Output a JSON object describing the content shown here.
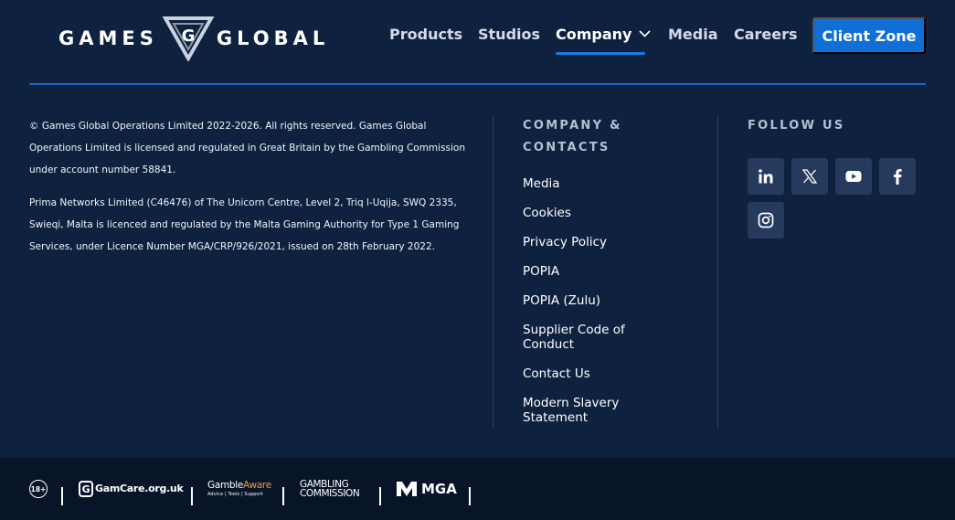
{
  "brand": {
    "word_left": "GAMES",
    "word_right": "GLOBAL",
    "mark_letter": "G"
  },
  "nav": {
    "items": [
      {
        "label": "Products"
      },
      {
        "label": "Studios"
      },
      {
        "label": "Company"
      },
      {
        "label": "Media"
      },
      {
        "label": "Careers"
      }
    ],
    "active": "Company",
    "cta_label": "Client Zone"
  },
  "legal": {
    "paragraph_1": "© Games Global Operations Limited 2022-2026. All rights reserved. Games Global Operations Limited is licensed and regulated in Great Britain by the Gambling Commission under account number 58841.",
    "paragraph_2": "Prima Networks Limited (C46476) of The Unicorn Centre, Level 2, Triq l-Uqija, SWQ 2335, Swieqi, Malta is licenced and regulated by the Malta Gaming Authority for Type 1 Gaming Services, under Licence Number MGA/CRP/926/2021, issued on 28th February 2022."
  },
  "company": {
    "title_line_1": "COMPANY &",
    "title_line_2": "CONTACTS",
    "links": [
      {
        "label": "Media"
      },
      {
        "label": "Cookies"
      },
      {
        "label": "Privacy Policy"
      },
      {
        "label": "POPIA"
      },
      {
        "label": "POPIA (Zulu)"
      },
      {
        "label": "Supplier Code of Conduct"
      },
      {
        "label": "Contact Us"
      },
      {
        "label": "Modern Slavery Statement"
      }
    ]
  },
  "follow": {
    "title": "FOLLOW US",
    "icons": [
      "linkedin-icon",
      "x-icon",
      "youtube-icon",
      "facebook-icon",
      "instagram-icon"
    ]
  },
  "bottom": {
    "age_badge": "18+",
    "gamcare_g": "G",
    "gamcare": "GamCare.org.uk",
    "gambleaware_a": "Gamble",
    "gambleaware_b": "Aware",
    "gambleaware_tag": "Advice | Tools | Support",
    "commission_1": "GAMBLING",
    "commission_2": "COMMISSION",
    "mga": "MGA"
  },
  "colors": {
    "background": "#0e2240",
    "accent": "#0f6fd6",
    "rule": "#1f66c8",
    "bottom_bar": "#081529",
    "social_tile": "#253a5c",
    "gambleaware_orange": "#f29a3a"
  }
}
